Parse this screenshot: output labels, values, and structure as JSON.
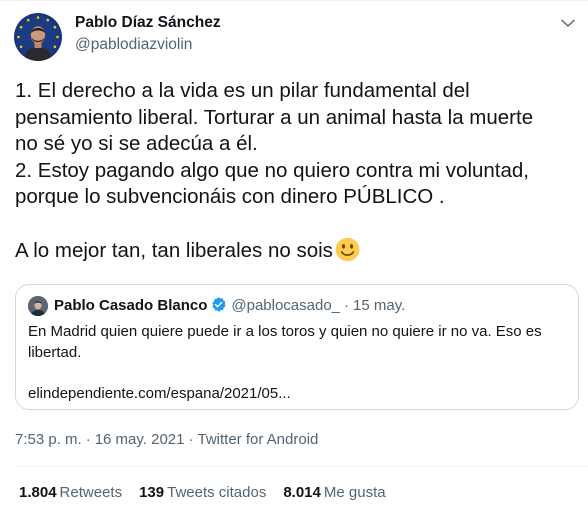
{
  "author": {
    "name": "Pablo Díaz Sánchez",
    "handle": "@pablodiazviolin"
  },
  "tweet": {
    "text": "1. El derecho a la vida es un pilar fundamental del\npensamiento liberal. Torturar a un animal hasta la muerte\nno sé yo si se adecúa a él.\n2. Estoy pagando algo que no quiero contra mi voluntad,\nporque lo subvencionáis con dinero PÚBLICO .\n\nA lo mejor tan, tan liberales no sois",
    "emoji": "slightly-smiling-face-emoji"
  },
  "quoted": {
    "name": "Pablo Casado Blanco",
    "handle": "@pablocasado_",
    "separator": "·",
    "date": "15 may.",
    "text": "En Madrid quien quiere puede ir a los toros y quien no quiere ir no va. Eso es\nlibertad.\n\nelindependiente.com/espana/2021/05..."
  },
  "meta": {
    "time": "7:53 p. m.",
    "separator": "·",
    "date": "16 may. 2021",
    "source": "Twitter for Android"
  },
  "stats": [
    {
      "value": "1.804",
      "label": "Retweets"
    },
    {
      "value": "139",
      "label": "Tweets citados"
    },
    {
      "value": "8.014",
      "label": "Me gusta"
    }
  ],
  "icons": {
    "more": "chevron-down-icon",
    "verified": "verified-badge-icon"
  },
  "colors": {
    "text": "#0f1419",
    "secondary": "#536471",
    "border": "#cfd9de",
    "verified": "#1d9bf0",
    "avatar_bg": "#1a3a82"
  }
}
